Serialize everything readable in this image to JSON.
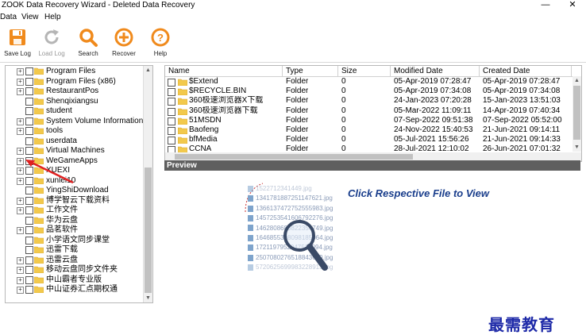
{
  "window": {
    "title": "ZOOK Data Recovery Wizard - Deleted Data Recovery",
    "minimize": "—",
    "close": "✕"
  },
  "menu": [
    "Data",
    "View",
    "Help"
  ],
  "toolbar": [
    {
      "label": "Save Log",
      "icon": "save-icon",
      "enabled": true
    },
    {
      "label": "Load Log",
      "icon": "refresh-icon",
      "enabled": false
    },
    {
      "label": "Search",
      "icon": "search-icon",
      "enabled": true
    },
    {
      "label": "Recover",
      "icon": "recover-icon",
      "enabled": true
    },
    {
      "label": "Help",
      "icon": "help-icon",
      "enabled": true
    }
  ],
  "tree": [
    {
      "label": "Program Files",
      "expandable": true
    },
    {
      "label": "Program Files (x86)",
      "expandable": true
    },
    {
      "label": "RestaurantPos",
      "expandable": true
    },
    {
      "label": "Shenqixiangsu",
      "expandable": false
    },
    {
      "label": "student",
      "expandable": false
    },
    {
      "label": "System Volume Information",
      "expandable": true
    },
    {
      "label": "tools",
      "expandable": true
    },
    {
      "label": "userdata",
      "expandable": false
    },
    {
      "label": "Virtual Machines",
      "expandable": true
    },
    {
      "label": "WeGameApps",
      "expandable": true
    },
    {
      "label": "XUEXI",
      "expandable": true
    },
    {
      "label": "xunlei10",
      "expandable": true
    },
    {
      "label": "YingShiDownload",
      "expandable": false
    },
    {
      "label": "博学智云下载资料",
      "expandable": true
    },
    {
      "label": "工作文件",
      "expandable": true
    },
    {
      "label": "华为云盘",
      "expandable": false
    },
    {
      "label": "品茗软件",
      "expandable": true
    },
    {
      "label": "小学语文同步课堂",
      "expandable": false
    },
    {
      "label": "迅雷下载",
      "expandable": false
    },
    {
      "label": "迅雷云盘",
      "expandable": true
    },
    {
      "label": "移动云盘同步文件夹",
      "expandable": true
    },
    {
      "label": "中山霸者专业版",
      "expandable": true
    },
    {
      "label": "中山证券汇点期权通",
      "expandable": true
    }
  ],
  "table": {
    "columns": [
      "Name",
      "Type",
      "Size",
      "Modified Date",
      "Created Date"
    ],
    "rows": [
      [
        "$Extend",
        "Folder",
        "0",
        "05-Apr-2019 07:28:47",
        "05-Apr-2019 07:28:47"
      ],
      [
        "$RECYCLE.BIN",
        "Folder",
        "0",
        "05-Apr-2019 07:34:08",
        "05-Apr-2019 07:34:08"
      ],
      [
        "360极速浏览器X下载",
        "Folder",
        "0",
        "24-Jan-2023 07:20:28",
        "15-Jan-2023 13:51:03"
      ],
      [
        "360极速浏览器下载",
        "Folder",
        "0",
        "05-Mar-2022 11:09:11",
        "14-Apr-2019 07:40:34"
      ],
      [
        "51MSDN",
        "Folder",
        "0",
        "07-Sep-2022 09:51:38",
        "07-Sep-2022 05:52:00"
      ],
      [
        "Baofeng",
        "Folder",
        "0",
        "24-Nov-2022 15:40:53",
        "21-Jun-2021 09:14:11"
      ],
      [
        "bfMedia",
        "Folder",
        "0",
        "05-Jul-2021 15:56:26",
        "21-Jun-2021 09:14:33"
      ],
      [
        "CCNA",
        "Folder",
        "0",
        "28-Jul-2021 12:10:02",
        "26-Jun-2021 07:01:32"
      ]
    ]
  },
  "preview": {
    "header": "Preview",
    "message": "Click Respective File to View",
    "files": [
      "1522712341449.jpg",
      "1341781887251147621.jpg",
      "1366137472752555983.jpg",
      "1457253541606792276.jpg",
      "1462808680822354749.jpg",
      "1646855308098185964.jpg",
      "1721197952047510094.jpg",
      "2507080276518843629.jpg",
      "5720625699983228913.jpg"
    ]
  },
  "watermark": "最需教育",
  "colors": {
    "accent_orange": "#f08a1c",
    "preview_bar": "#5f5f5f",
    "preview_text": "#1a3e8c",
    "folder": "#f2c94c",
    "watermark": "#1e2aa8"
  }
}
